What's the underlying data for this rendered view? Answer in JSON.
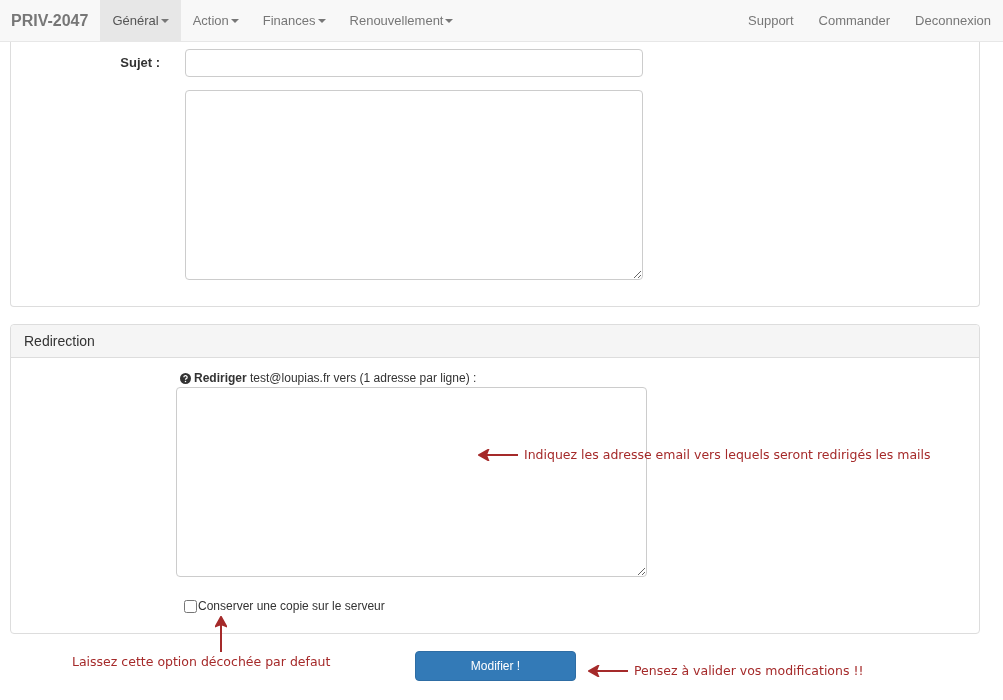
{
  "navbar": {
    "brand": "PRIV-2047",
    "menus": [
      {
        "label": "Général",
        "selected": true
      },
      {
        "label": "Action",
        "selected": false
      },
      {
        "label": "Finances",
        "selected": false
      },
      {
        "label": "Renouvellement",
        "selected": false
      }
    ],
    "links": [
      "Support",
      "Commander",
      "Deconnexion"
    ]
  },
  "message_panel": {
    "subject_label": "Sujet :"
  },
  "redirection_panel": {
    "title": "Redirection",
    "label": "**Rediriger** test@loupias.fr vers (1 adresse par ligne) :",
    "keep_copy": {
      "label": "Conserver une copie sur le serveur",
      "checked": false
    }
  },
  "submit_button": "Modifier !",
  "annotations": {
    "addresses": "Indiquez les adresse email vers lequels seront  redirigés les mails",
    "checkbox": "Laissez cette option décochée par defaut",
    "submit": "Pensez à valider vos modifications !!"
  }
}
